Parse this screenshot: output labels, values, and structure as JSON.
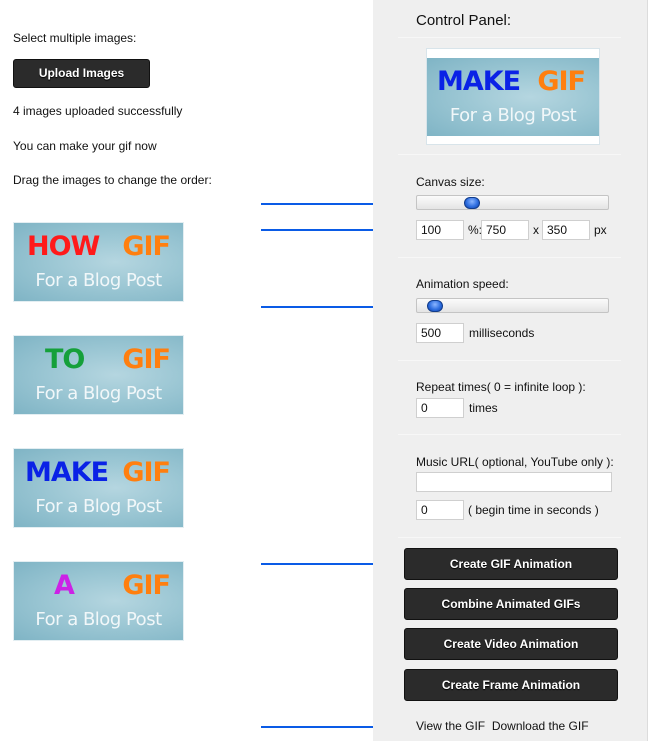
{
  "left": {
    "select_label": "Select multiple images:",
    "upload_button": "Upload Images",
    "status_uploaded": "4 images uploaded successfully",
    "status_ready": "You can make your gif now",
    "drag_hint": "Drag the images to change the order:",
    "images": [
      {
        "word": "HOW",
        "word_color": "#ff1a1a",
        "gif": "GIF",
        "subtitle": "For a Blog Post"
      },
      {
        "word": "TO",
        "word_color": "#15a03a",
        "gif": "GIF",
        "subtitle": "For a Blog Post"
      },
      {
        "word": "MAKE",
        "word_color": "#0a22e6",
        "gif": "GIF",
        "subtitle": "For a Blog Post"
      },
      {
        "word": "A",
        "word_color": "#cc22e6",
        "gif": "GIF",
        "subtitle": "For a Blog Post"
      }
    ]
  },
  "panel": {
    "title": "Control Panel:",
    "preview": {
      "word": "MAKE",
      "word_color": "#0a22e6",
      "gif": "GIF",
      "subtitle": "For a Blog Post"
    },
    "canvas": {
      "label": "Canvas size:",
      "slider_fraction": 0.27,
      "percent_value": "100",
      "percent_suffix": "%:",
      "width_value": "750",
      "x_label": "x",
      "height_value": "350",
      "px_label": "px"
    },
    "speed": {
      "label": "Animation speed:",
      "slider_fraction": 0.06,
      "value": "500",
      "unit": "milliseconds"
    },
    "repeat": {
      "label": "Repeat times( 0 = infinite loop ):",
      "value": "0",
      "unit": "times"
    },
    "music": {
      "label": "Music URL( optional, YouTube only ):",
      "url_value": "",
      "begin_value": "0",
      "begin_label": "( begin time in seconds )"
    },
    "buttons": {
      "create_gif": "Create GIF Animation",
      "combine": "Combine Animated GIFs",
      "create_video": "Create Video Animation",
      "create_frame": "Create Frame Animation"
    },
    "links": {
      "view": "View the GIF",
      "download": "Download the GIF"
    }
  },
  "colors": {
    "arrow": "#0a5be6",
    "gif_orange": "#ff7f0f",
    "button_dark": "#2b2b2b",
    "panel_bg": "#efefef"
  }
}
